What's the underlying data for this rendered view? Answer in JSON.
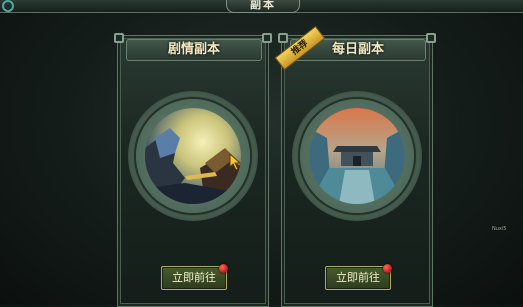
{
  "header": {
    "title": "副本"
  },
  "side_label": "Nuxi5",
  "cards": [
    {
      "title": "剧情副本",
      "button_label": "立即前往"
    },
    {
      "title": "每日副本",
      "button_label": "立即前往",
      "ribbon": "推荐"
    }
  ]
}
